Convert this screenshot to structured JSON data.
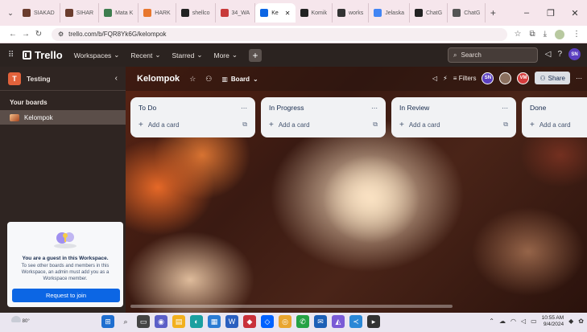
{
  "browser": {
    "tabs": [
      {
        "label": "SIAKAD",
        "color": "#6b3d2e",
        "active": false
      },
      {
        "label": "SIHAR",
        "color": "#6b3d2e",
        "active": false
      },
      {
        "label": "Mata K",
        "color": "#3e7d4f",
        "active": false
      },
      {
        "label": "HARK",
        "color": "#e8772e",
        "active": false
      },
      {
        "label": "shellco",
        "color": "#222222",
        "active": false
      },
      {
        "label": "34_WA",
        "color": "#c83a3a",
        "active": false
      },
      {
        "label": "Ke",
        "color": "#0c66e4",
        "active": true
      },
      {
        "label": "Komik",
        "color": "#222222",
        "active": false
      },
      {
        "label": "works",
        "color": "#333333",
        "active": false
      },
      {
        "label": "Jelaska",
        "color": "#4285f4",
        "active": false
      },
      {
        "label": "ChatG",
        "color": "#222222",
        "active": false
      },
      {
        "label": "ChatG",
        "color": "#555555",
        "active": false
      }
    ],
    "new_tab": "+",
    "url": "trello.com/b/FQR8Yk6G/kelompok"
  },
  "header": {
    "logo": "Trello",
    "menus": [
      "Workspaces",
      "Recent",
      "Starred",
      "More"
    ],
    "search_placeholder": "Search",
    "avatar": "SN"
  },
  "sidebar": {
    "workspace_initial": "T",
    "workspace_name": "Testing",
    "your_boards": "Your boards",
    "board_item": "Kelompok",
    "guest_title": "You are a guest in this Workspace.",
    "guest_body": "To see other boards and members in this Workspace, an admin must add you as a Workspace member.",
    "join_button": "Request to join"
  },
  "board": {
    "title": "Kelompok",
    "view": "Board",
    "filters": "Filters",
    "members": [
      {
        "initials": "SN",
        "color": "#5b3fbf"
      },
      {
        "initials": "",
        "color": "#8a6f5e"
      },
      {
        "initials": "VM",
        "color": "#d63c3c"
      }
    ],
    "share": "Share",
    "add_card": "Add a card",
    "lists": [
      {
        "title": "To Do"
      },
      {
        "title": "In Progress"
      },
      {
        "title": "In Review"
      },
      {
        "title": "Done"
      }
    ]
  },
  "taskbar": {
    "temperature": "80°",
    "time": "10:55 AM",
    "date": "9/4/2024"
  }
}
